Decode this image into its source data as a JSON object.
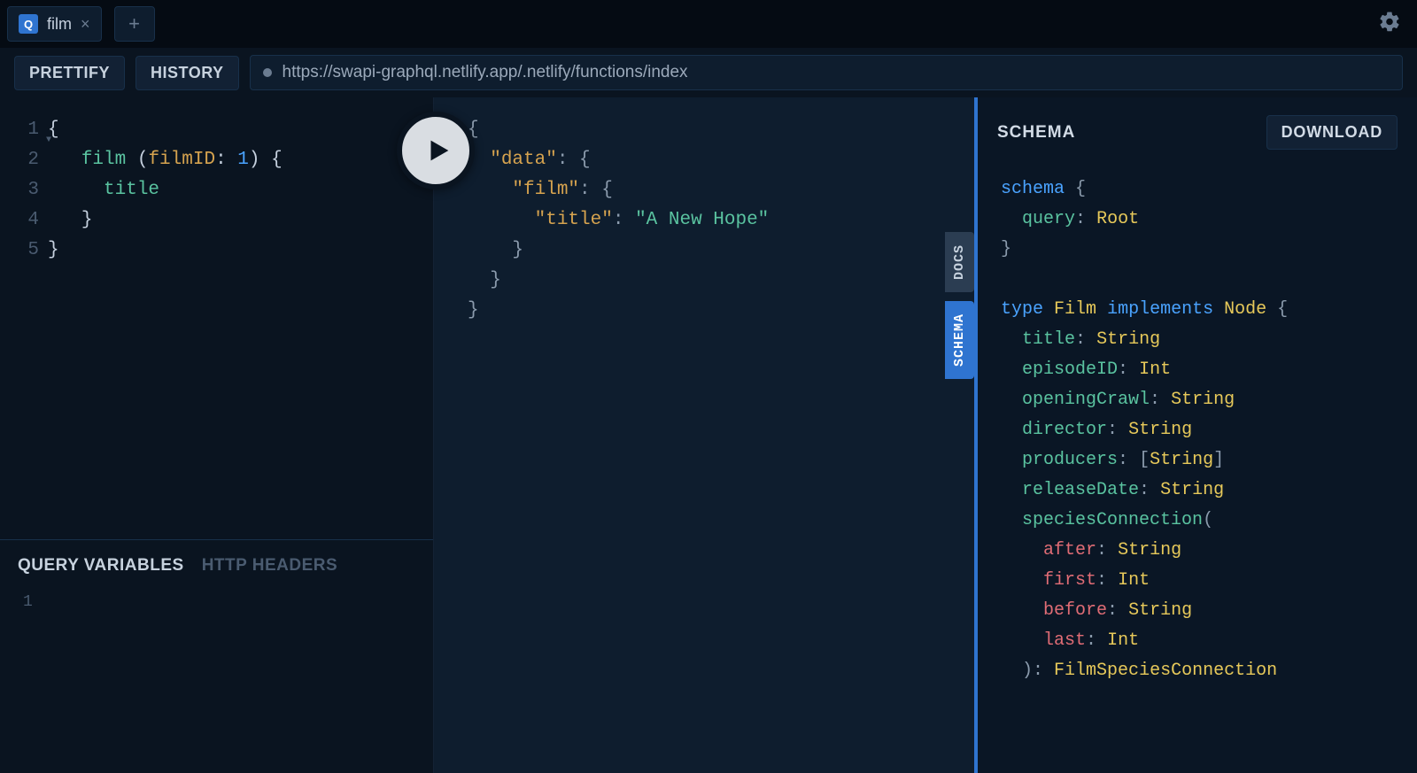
{
  "tabs": {
    "active": {
      "badge": "Q",
      "label": "film"
    }
  },
  "toolbar": {
    "prettify": "PRETTIFY",
    "history": "HISTORY",
    "endpoint": "https://swapi-graphql.netlify.app/.netlify/functions/index"
  },
  "editor": {
    "lines": [
      "1",
      "2",
      "3",
      "4",
      "5"
    ],
    "code": {
      "l1_open": "{",
      "l2_field": "film",
      "l2_arg": "filmID",
      "l2_colon": ": ",
      "l2_num": "1",
      "l2_open": ") {",
      "l3_field": "title",
      "l4_close": "}",
      "l5_close": "}"
    }
  },
  "vars": {
    "tab_query": "QUERY VARIABLES",
    "tab_headers": "HTTP HEADERS",
    "line1": "1"
  },
  "results": {
    "l1_open": "{",
    "l2_key": "\"data\"",
    "l2_open": ": {",
    "l3_key": "\"film\"",
    "l3_open": ": {",
    "l4_key": "\"title\"",
    "l4_colon": ": ",
    "l4_val": "\"A New Hope\"",
    "l5_close": "}",
    "l6_close": "}",
    "l7_close": "}"
  },
  "side": {
    "docs": "DOCS",
    "schema": "SCHEMA"
  },
  "schema_panel": {
    "title": "SCHEMA",
    "download": "DOWNLOAD",
    "kw_schema": "schema",
    "kw_query": "query",
    "root_type": "Root",
    "kw_type": "type",
    "type_film": "Film",
    "kw_implements": "implements",
    "type_node": "Node",
    "f_title": "title",
    "t_string": "String",
    "f_episodeID": "episodeID",
    "t_int": "Int",
    "f_openingCrawl": "openingCrawl",
    "f_director": "director",
    "f_producers": "producers",
    "f_releaseDate": "releaseDate",
    "f_speciesConnection": "speciesConnection",
    "a_after": "after",
    "a_first": "first",
    "a_before": "before",
    "a_last": "last",
    "t_filmSpecies": "FilmSpeciesConnection"
  }
}
